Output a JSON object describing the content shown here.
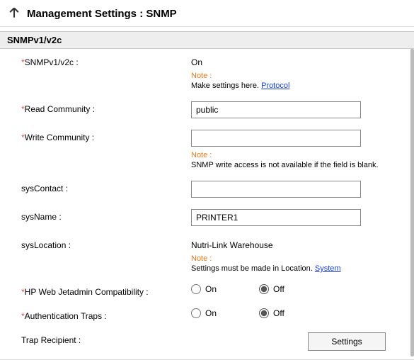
{
  "header": {
    "title": "Management Settings : SNMP"
  },
  "section": {
    "title": "SNMPv1/v2c"
  },
  "fields": {
    "snmp": {
      "label": "SNMPv1/v2c :",
      "value": "On",
      "note_label": "Note :",
      "note_body_prefix": "Make settings here. ",
      "note_link": "Protocol"
    },
    "read_community": {
      "label": "Read Community :",
      "value": "public"
    },
    "write_community": {
      "label": "Write Community :",
      "value": "",
      "note_label": "Note :",
      "note_body": "SNMP write access is not available if the field is blank."
    },
    "sys_contact": {
      "label": "sysContact :",
      "value": ""
    },
    "sys_name": {
      "label": "sysName :",
      "value": "PRINTER1"
    },
    "sys_location": {
      "label": "sysLocation :",
      "value": "Nutri-Link Warehouse",
      "note_label": "Note :",
      "note_body_prefix": "Settings must be made in Location. ",
      "note_link": "System"
    },
    "hp_compat": {
      "label": "HP Web Jetadmin Compatibility :",
      "opt_on": "On",
      "opt_off": "Off",
      "selected": "Off"
    },
    "auth_traps": {
      "label": "Authentication Traps :",
      "opt_on": "On",
      "opt_off": "Off",
      "selected": "Off"
    },
    "trap_recipient": {
      "label": "Trap Recipient :",
      "button": "Settings"
    }
  }
}
